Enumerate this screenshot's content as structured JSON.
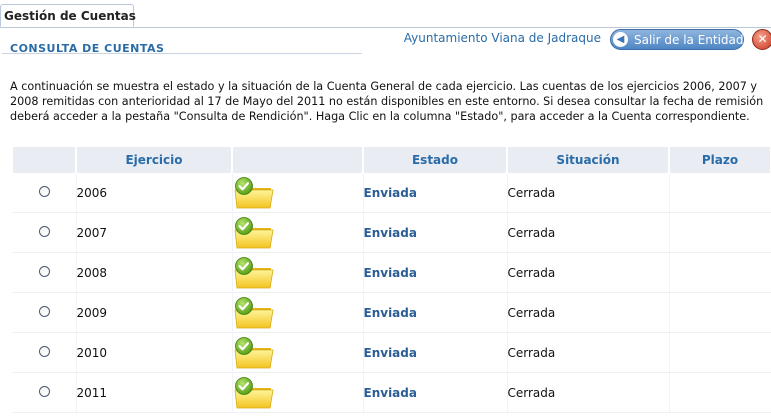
{
  "tabs": {
    "active": "Gestión de Cuentas"
  },
  "header": {
    "section_title": "CONSULTA DE CUENTAS",
    "entity_name": "Ayuntamiento Viana de Jadraque",
    "exit_label": "Salir de la Entidad",
    "close_glyph": "✕"
  },
  "intro_text": "A continuación se muestra el estado y la situación de la Cuenta General de cada ejercicio. Las cuentas de los ejercicios 2006, 2007 y 2008 remitidas con anterioridad al 17 de Mayo del 2011 no están disponibles en este entorno. Si desea consultar la fecha de remisión deberá acceder a la pestaña \"Consulta de Rendición\". Haga Clic en la columna \"Estado\", para acceder a la Cuenta correspondiente.",
  "table": {
    "headers": {
      "radio": "",
      "ejercicio": "Ejercicio",
      "icon": "",
      "estado": "Estado",
      "situacion": "Situación",
      "plazo": "Plazo"
    },
    "rows": [
      {
        "year": "2006",
        "icon": "folder-check-icon",
        "estado": "Enviada",
        "situacion": "Cerrada",
        "plazo": ""
      },
      {
        "year": "2007",
        "icon": "folder-check-icon",
        "estado": "Enviada",
        "situacion": "Cerrada",
        "plazo": ""
      },
      {
        "year": "2008",
        "icon": "folder-check-icon",
        "estado": "Enviada",
        "situacion": "Cerrada",
        "plazo": ""
      },
      {
        "year": "2009",
        "icon": "folder-check-icon",
        "estado": "Enviada",
        "situacion": "Cerrada",
        "plazo": ""
      },
      {
        "year": "2010",
        "icon": "folder-check-icon",
        "estado": "Enviada",
        "situacion": "Cerrada",
        "plazo": ""
      },
      {
        "year": "2011",
        "icon": "folder-check-icon",
        "estado": "Enviada",
        "situacion": "Cerrada",
        "plazo": ""
      }
    ]
  },
  "colors": {
    "accent": "#2a6ca8",
    "header_bg": "#e9edf3"
  }
}
